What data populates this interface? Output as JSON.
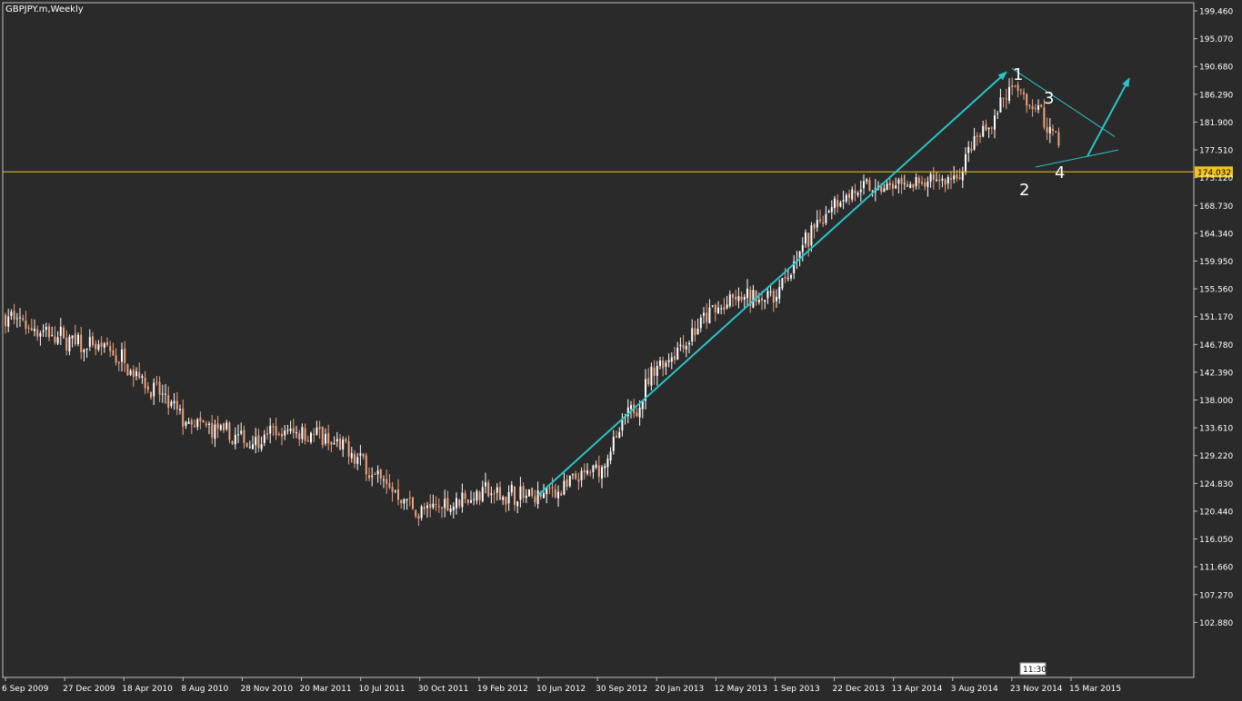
{
  "chart_data": {
    "type": "candlestick",
    "title": "GBPJPY.m,Weekly",
    "symbol": "GBPJPY.m",
    "timeframe": "Weekly",
    "y_ticks": [
      "199.460",
      "195.070",
      "190.680",
      "186.290",
      "181.900",
      "177.510",
      "173.120",
      "168.730",
      "164.340",
      "159.950",
      "155.560",
      "151.170",
      "146.780",
      "142.390",
      "138.000",
      "133.610",
      "129.220",
      "124.830",
      "120.440",
      "116.050",
      "111.660",
      "107.270",
      "102.880"
    ],
    "ylim": [
      98.49,
      199.46
    ],
    "x_ticks": [
      "6 Sep 2009",
      "27 Dec 2009",
      "18 Apr 2010",
      "8 Aug 2010",
      "28 Nov 2010",
      "20 Mar 2011",
      "10 Jul 2011",
      "30 Oct 2011",
      "19 Feb 2012",
      "10 Jun 2012",
      "30 Sep 2012",
      "20 Jan 2013",
      "12 May 2013",
      "1 Sep 2013",
      "22 Dec 2013",
      "13 Apr 2014",
      "3 Aug 2014",
      "23 Nov 2014",
      "15 Mar 2015"
    ],
    "current_price": "174.032",
    "server_time": "11:30",
    "wave_labels": [
      "1",
      "2",
      "3",
      "4"
    ],
    "colors": {
      "background": "#2a2a2a",
      "axis": "#c0c0c0",
      "bull_candle": "#ffffff",
      "bear_candle": "#f0a27e",
      "price_line": "#f2c21b",
      "trend_arrow": "#27c6cc",
      "triangle_lines": "#27c6cc",
      "label": "#ffffff"
    },
    "price_path": [
      {
        "date": "6 Sep 2009",
        "price": 151.2
      },
      {
        "date": "27 Dec 2009",
        "price": 147.5
      },
      {
        "date": "18 Apr 2010",
        "price": 144.5
      },
      {
        "date": "8 Aug 2010",
        "price": 134.5
      },
      {
        "date": "28 Nov 2010",
        "price": 131.5
      },
      {
        "date": "20 Mar 2011",
        "price": 133.5
      },
      {
        "date": "10 Jul 2011",
        "price": 128.5
      },
      {
        "date": "30 Oct 2011",
        "price": 120.0
      },
      {
        "date": "19 Feb 2012",
        "price": 123.5
      },
      {
        "date": "10 Jun 2012",
        "price": 122.5
      },
      {
        "date": "30 Sep 2012",
        "price": 126.5
      },
      {
        "date": "20 Jan 2013",
        "price": 143.5
      },
      {
        "date": "12 May 2013",
        "price": 152.5
      },
      {
        "date": "1 Sep 2013",
        "price": 155.0
      },
      {
        "date": "22 Dec 2013",
        "price": 170.5
      },
      {
        "date": "13 Apr 2014",
        "price": 171.5
      },
      {
        "date": "3 Aug 2014",
        "price": 172.5
      },
      {
        "date": "23 Nov 2014",
        "price": 187.5
      },
      {
        "date": "15 Mar 2015",
        "price": 177.0
      }
    ],
    "annotations": {
      "uptrend_arrow": {
        "from": {
          "date": "10 Jun 2012",
          "price": 123.0
        },
        "to": {
          "date": "23 Nov 2014",
          "price": 189.8
        }
      },
      "triangle_upper": {
        "from": {
          "date": "23 Nov 2014",
          "price": 190.4
        },
        "to": {
          "date": "15 Mar 2015",
          "price": 179.6
        }
      },
      "triangle_lower": {
        "from": {
          "date": "23 Nov 2014",
          "price": 174.8
        },
        "to": {
          "date": "15 Mar 2015",
          "price": 177.5
        }
      },
      "breakout_arrow": {
        "from": {
          "date": "15 Mar 2015",
          "price": 176.5
        },
        "to": {
          "date": "15 Mar 2015",
          "price": 188.8
        }
      }
    }
  }
}
